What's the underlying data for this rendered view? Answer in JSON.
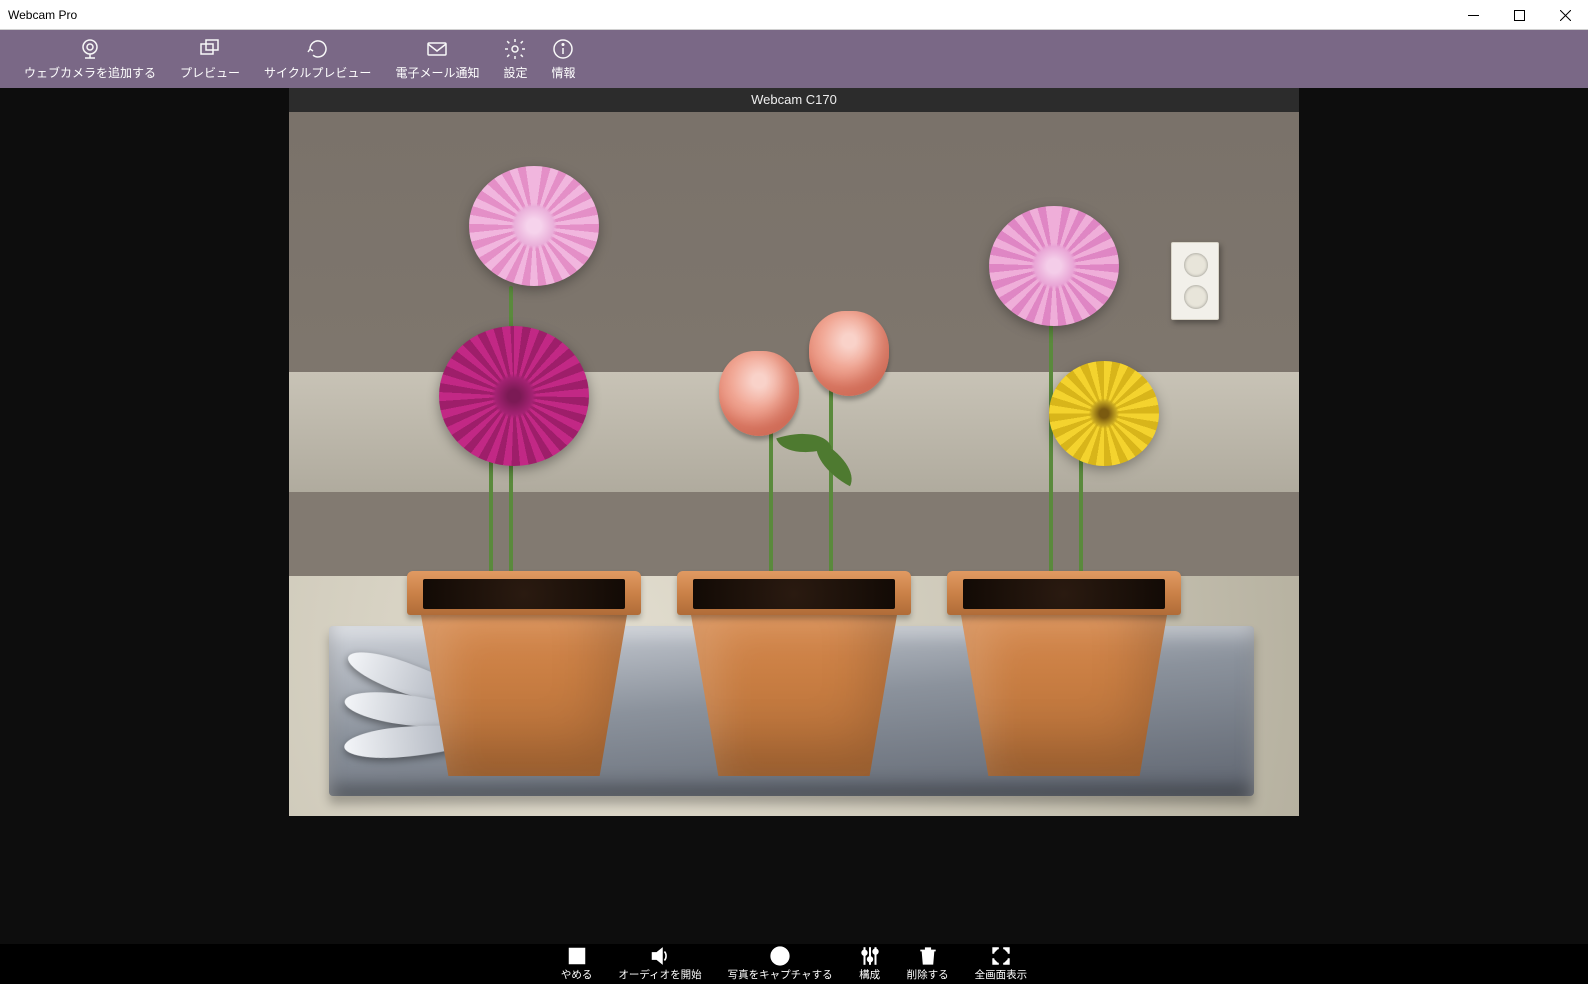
{
  "window": {
    "title": "Webcam Pro"
  },
  "toolbar": {
    "add_webcam": "ウェブカメラを追加する",
    "preview": "プレビュー",
    "cycle_preview": "サイクルプレビュー",
    "email_notify": "電子メール通知",
    "settings": "設定",
    "info": "情報"
  },
  "camera": {
    "name": "Webcam C170"
  },
  "bottombar": {
    "stop": "やめる",
    "start_audio": "オーディオを開始",
    "capture": "写真をキャプチャする",
    "configure": "構成",
    "delete": "削除する",
    "fullscreen": "全画面表示"
  }
}
